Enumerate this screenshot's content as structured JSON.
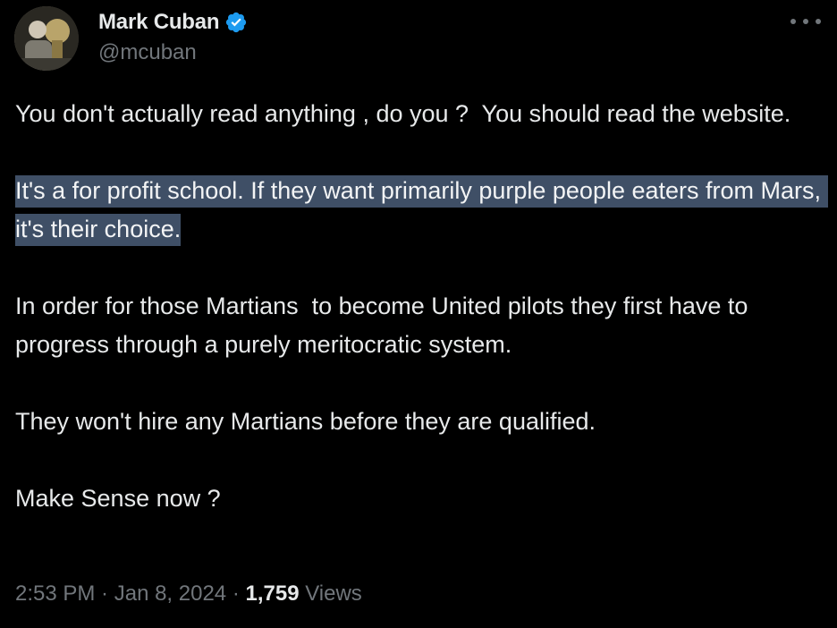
{
  "author": {
    "display_name": "Mark Cuban",
    "handle": "@mcuban",
    "verified": true,
    "verified_color": "#1d9bf0"
  },
  "tweet": {
    "p1": "You don't actually read anything , do you ?  You should read the website.",
    "p2": "It's a for profit school. If they want primarily purple people eaters from Mars, it's their choice.",
    "p3": "In order for those Martians  to become United pilots they first have to progress through a purely meritocratic system.",
    "p4": "They won't hire any Martians before they are qualified.",
    "p5": "Make Sense now ?"
  },
  "meta": {
    "time": "2:53 PM",
    "sep1": " · ",
    "date": "Jan 8, 2024",
    "sep2": " · ",
    "views_count": "1,759",
    "views_label": " Views"
  },
  "icons": {
    "more": "more-options-icon",
    "verified": "verified-badge-icon"
  },
  "colors": {
    "background": "#000000",
    "text": "#e7e9ea",
    "secondary": "#71767b",
    "selection": "#3f4f66"
  }
}
